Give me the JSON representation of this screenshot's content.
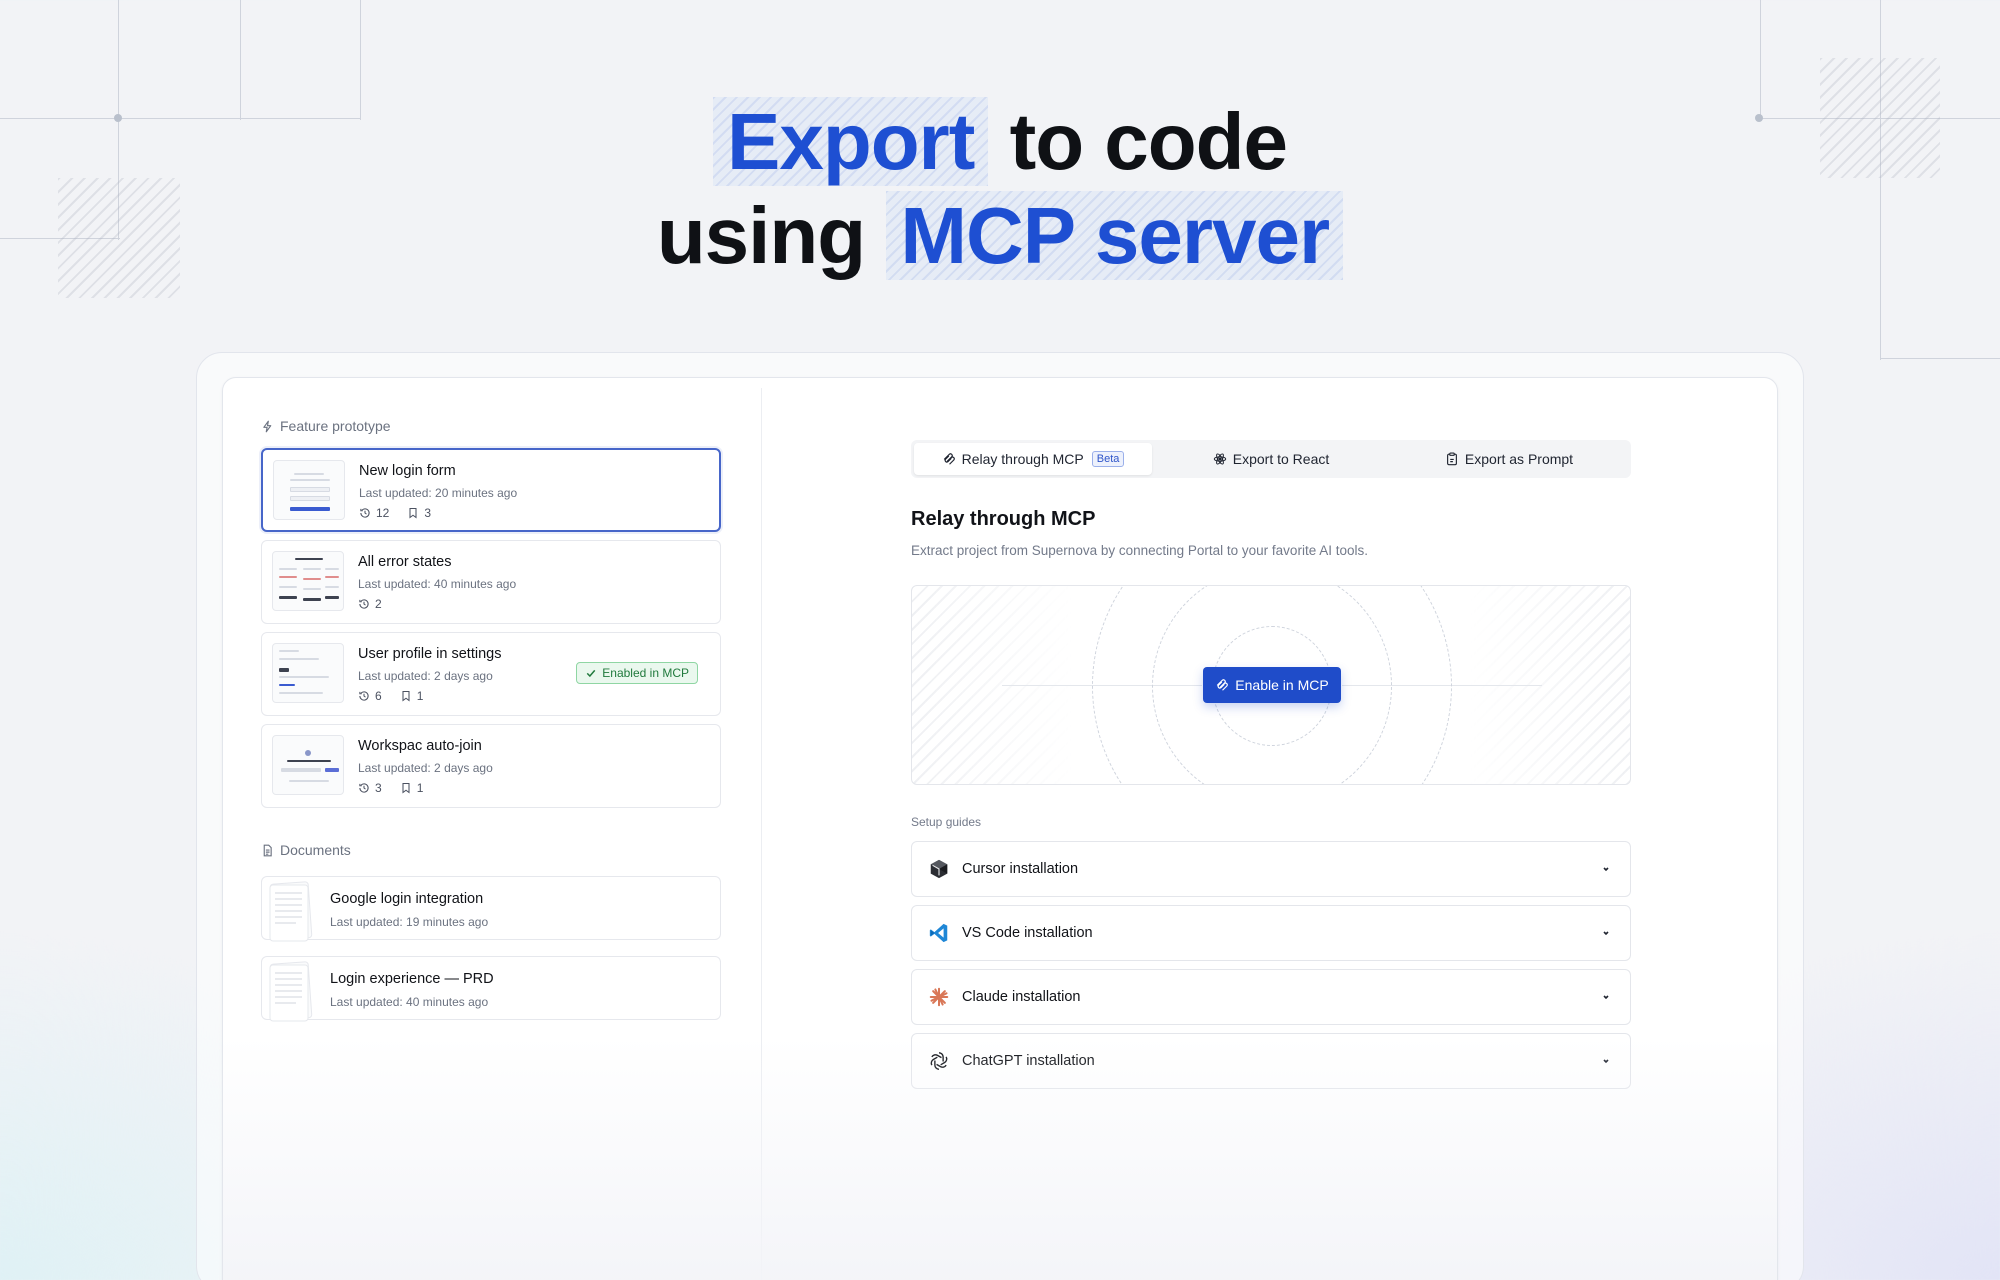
{
  "headline": {
    "line1_highlight": "Export",
    "line1_rest": "to code",
    "line2_start": "using",
    "line2_highlight": "MCP server"
  },
  "colors": {
    "accent": "#1e4fd2",
    "button": "#1f4cc9",
    "success": "#217a3d",
    "selected_border": "#4766c9"
  },
  "left_panel": {
    "prototype_section_label": "Feature prototype",
    "prototypes": [
      {
        "title": "New login form",
        "updated": "Last updated: 20 minutes ago",
        "versions": "12",
        "bookmarks": "3",
        "selected": true
      },
      {
        "title": "All error states",
        "updated": "Last updated: 40 minutes ago",
        "versions": "2"
      },
      {
        "title": "User profile in settings",
        "updated": "Last updated: 2 days ago",
        "versions": "6",
        "bookmarks": "1",
        "badge": "Enabled in MCP"
      },
      {
        "title": "Workspac auto-join",
        "updated": "Last updated: 2 days ago",
        "versions": "3",
        "bookmarks": "1"
      }
    ],
    "documents_section_label": "Documents",
    "documents": [
      {
        "title": "Google login integration",
        "updated": "Last updated: 19 minutes ago"
      },
      {
        "title": "Login experience — PRD",
        "updated": "Last updated: 40 minutes ago"
      }
    ]
  },
  "right_panel": {
    "tabs": [
      {
        "label": "Relay through MCP",
        "badge": "Beta",
        "icon": "mcp-icon",
        "active": true
      },
      {
        "label": "Export to React",
        "icon": "react-icon"
      },
      {
        "label": "Export as Prompt",
        "icon": "clipboard-icon"
      }
    ],
    "title": "Relay through MCP",
    "subtitle": "Extract project from Supernova by connecting Portal to your favorite AI tools.",
    "enable_button": "Enable in MCP",
    "setup_label": "Setup guides",
    "guides": [
      {
        "label": "Cursor installation",
        "icon": "cursor-logo-icon"
      },
      {
        "label": "VS Code installation",
        "icon": "vscode-logo-icon"
      },
      {
        "label": "Claude installation",
        "icon": "claude-logo-icon"
      },
      {
        "label": "ChatGPT installation",
        "icon": "chatgpt-logo-icon"
      }
    ]
  }
}
